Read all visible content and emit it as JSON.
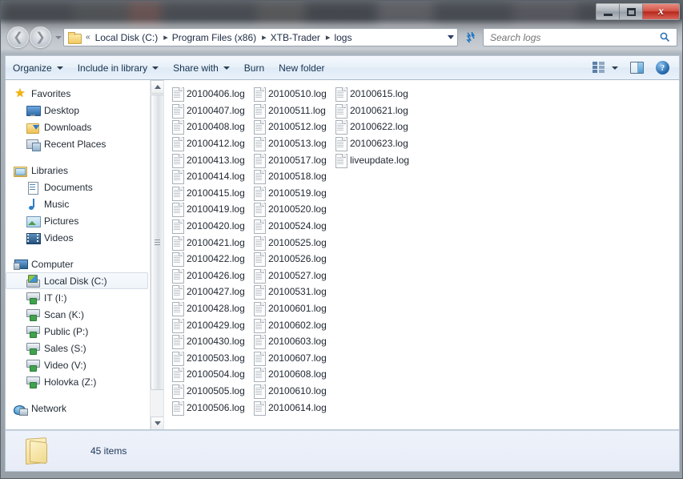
{
  "window": {
    "title": "",
    "controls": {
      "minimize": "Minimize",
      "maximize": "Maximize",
      "close": "Close",
      "close_glyph": "x"
    }
  },
  "nav": {
    "back": "Back",
    "forward": "Forward",
    "recent_pages": "Recent Pages",
    "breadcrumb_overflow": "«",
    "breadcrumbs": [
      {
        "label": "Local Disk (C:)"
      },
      {
        "label": "Program Files (x86)"
      },
      {
        "label": "XTB-Trader"
      },
      {
        "label": "logs"
      }
    ],
    "separator": "▸",
    "refresh": "↻",
    "refresh_glyph": "✨"
  },
  "search": {
    "placeholder": "Search logs",
    "value": "",
    "icon": "⌕"
  },
  "toolbar": {
    "items": [
      {
        "label": "Organize",
        "has_caret": true
      },
      {
        "label": "Include in library",
        "has_caret": true
      },
      {
        "label": "Share with",
        "has_caret": true
      },
      {
        "label": "Burn",
        "has_caret": false
      },
      {
        "label": "New folder",
        "has_caret": false
      }
    ],
    "change_view": "Change your view",
    "show_preview": "Show the preview pane",
    "help": "Get help",
    "help_glyph": "?"
  },
  "sidebar": {
    "groups": [
      {
        "name": "Favorites",
        "icon": "star-icon",
        "items": [
          {
            "label": "Desktop",
            "icon": "desktop-icon"
          },
          {
            "label": "Downloads",
            "icon": "downloads-icon"
          },
          {
            "label": "Recent Places",
            "icon": "recent-places-icon"
          }
        ]
      },
      {
        "name": "Libraries",
        "icon": "libraries-icon",
        "items": [
          {
            "label": "Documents",
            "icon": "documents-icon"
          },
          {
            "label": "Music",
            "icon": "music-icon"
          },
          {
            "label": "Pictures",
            "icon": "pictures-icon"
          },
          {
            "label": "Videos",
            "icon": "videos-icon"
          }
        ]
      },
      {
        "name": "Computer",
        "icon": "computer-icon",
        "items": [
          {
            "label": "Local Disk (C:)",
            "icon": "local-disk-icon",
            "selected": true
          },
          {
            "label": "IT (I:)",
            "icon": "network-drive-icon"
          },
          {
            "label": "Scan (K:)",
            "icon": "network-drive-icon"
          },
          {
            "label": "Public (P:)",
            "icon": "network-drive-icon"
          },
          {
            "label": "Sales (S:)",
            "icon": "network-drive-icon"
          },
          {
            "label": "Video (V:)",
            "icon": "network-drive-icon"
          },
          {
            "label": "Holovka (Z:)",
            "icon": "network-drive-icon"
          }
        ]
      },
      {
        "name": "Network",
        "icon": "network-icon",
        "items": []
      }
    ]
  },
  "files": [
    "20100406.log",
    "20100407.log",
    "20100408.log",
    "20100412.log",
    "20100413.log",
    "20100414.log",
    "20100415.log",
    "20100419.log",
    "20100420.log",
    "20100421.log",
    "20100422.log",
    "20100426.log",
    "20100427.log",
    "20100428.log",
    "20100429.log",
    "20100430.log",
    "20100503.log",
    "20100504.log",
    "20100505.log",
    "20100506.log",
    "20100510.log",
    "20100511.log",
    "20100512.log",
    "20100513.log",
    "20100517.log",
    "20100518.log",
    "20100519.log",
    "20100520.log",
    "20100524.log",
    "20100525.log",
    "20100526.log",
    "20100527.log",
    "20100531.log",
    "20100601.log",
    "20100602.log",
    "20100603.log",
    "20100607.log",
    "20100608.log",
    "20100610.log",
    "20100614.log",
    "20100615.log",
    "20100621.log",
    "20100622.log",
    "20100623.log",
    "liveupdate.log"
  ],
  "status": {
    "item_count": "45 items"
  },
  "colors": {
    "accent": "#1a74c4",
    "close_button": "#b8281c",
    "selection": "#cfe5f7",
    "text": "#1e2630",
    "folder_yellow": "#f2c861"
  }
}
